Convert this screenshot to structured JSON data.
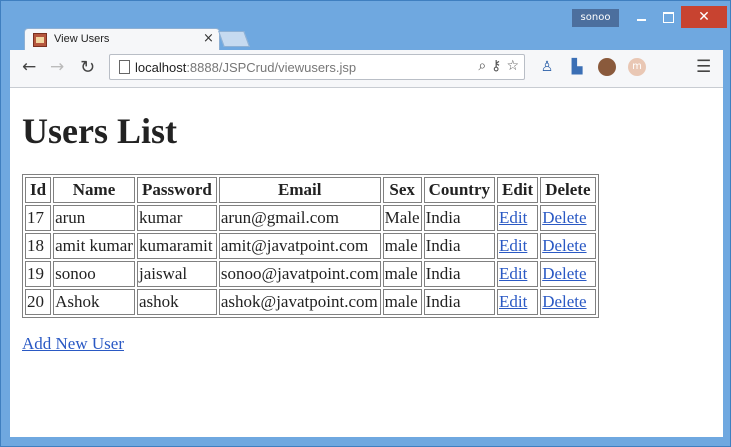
{
  "window": {
    "user_badge": "sonoo"
  },
  "tab": {
    "title": "View Users",
    "close_glyph": "×"
  },
  "toolbar": {
    "back_glyph": "←",
    "forward_glyph": "→",
    "reload_glyph": "↻",
    "url_host": "localhost",
    "url_path": ":8888/JSPCrud/viewusers.jsp",
    "icons": [
      "zoom-icon",
      "key-icon",
      "star-icon"
    ],
    "extensions": [
      "user-extension-icon",
      "chart-extension-icon",
      "avatar-extension-icon",
      "m-extension-icon"
    ],
    "menu_glyph": "☰"
  },
  "page": {
    "heading": "Users List",
    "columns": [
      "Id",
      "Name",
      "Password",
      "Email",
      "Sex",
      "Country",
      "Edit",
      "Delete"
    ],
    "rows": [
      {
        "id": "17",
        "name": "arun",
        "password": "kumar",
        "email": "arun@gmail.com",
        "sex": "Male",
        "country": "India",
        "edit": "Edit",
        "delete": "Delete"
      },
      {
        "id": "18",
        "name": "amit kumar",
        "password": "kumaramit",
        "email": "amit@javatpoint.com",
        "sex": "male",
        "country": "India",
        "edit": "Edit",
        "delete": "Delete"
      },
      {
        "id": "19",
        "name": "sonoo",
        "password": "jaiswal",
        "email": "sonoo@javatpoint.com",
        "sex": "male",
        "country": "India",
        "edit": "Edit",
        "delete": "Delete"
      },
      {
        "id": "20",
        "name": "Ashok",
        "password": "ashok",
        "email": "ashok@javatpoint.com",
        "sex": "male",
        "country": "India",
        "edit": "Edit",
        "delete": "Delete"
      }
    ],
    "add_link": "Add New User"
  },
  "colors": {
    "frame": "#6fa8e0",
    "close_button": "#c84330",
    "link": "#2a59c4"
  }
}
